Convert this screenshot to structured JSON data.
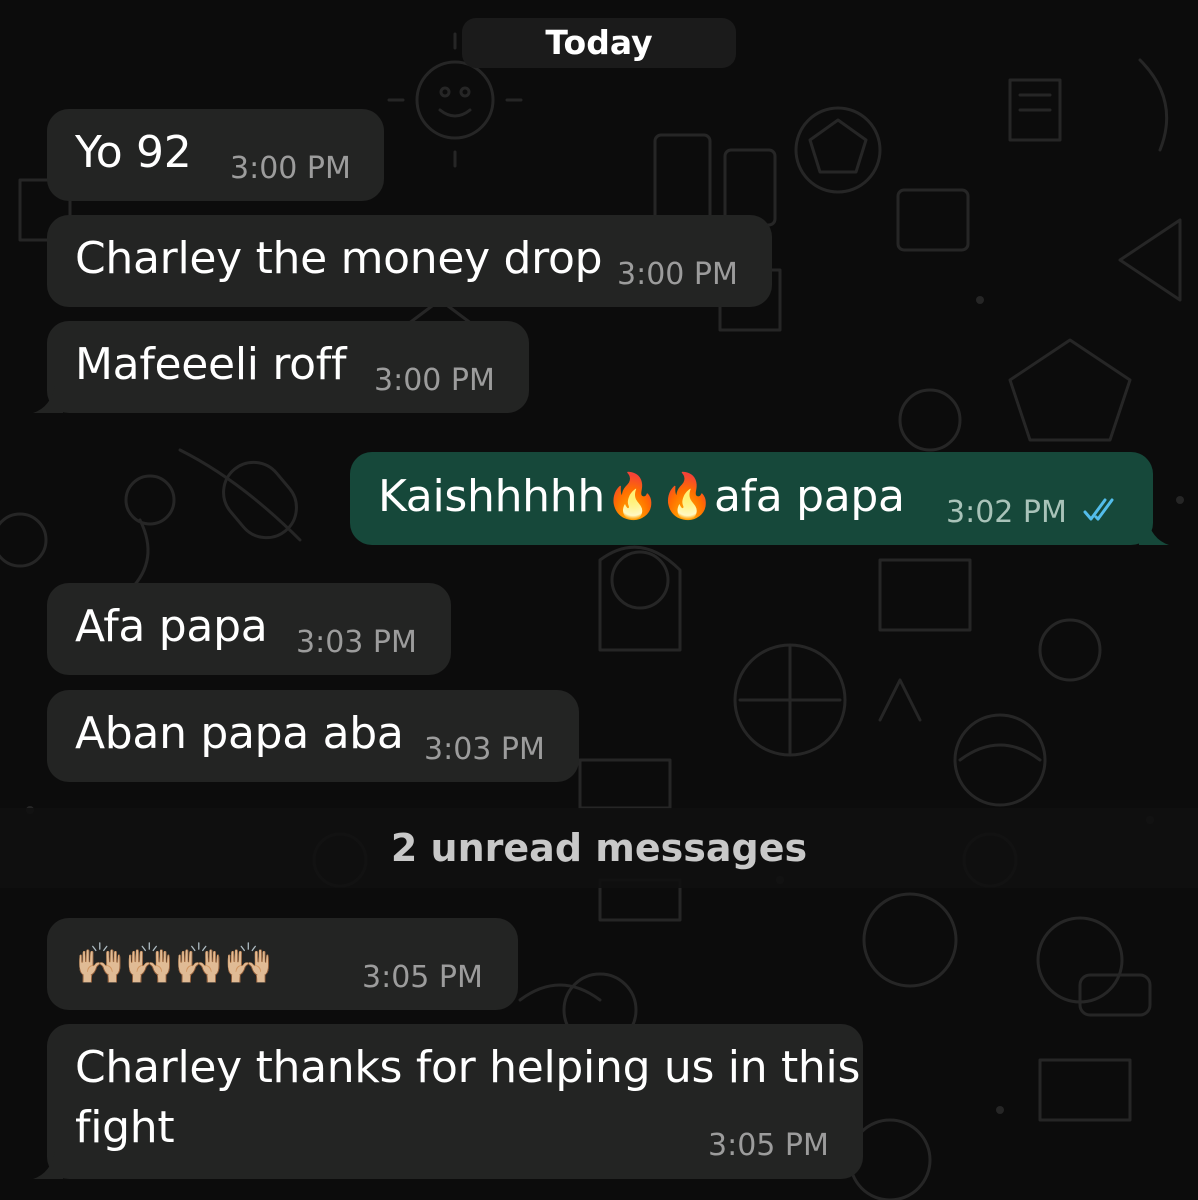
{
  "date_divider": "Today",
  "messages": [
    {
      "text": "Yo 92",
      "time": "3:00 PM",
      "direction": "incoming"
    },
    {
      "text": "Charley the money drop",
      "time": "3:00 PM",
      "direction": "incoming"
    },
    {
      "text": "Mafeeeli roff",
      "time": "3:00 PM",
      "direction": "incoming"
    },
    {
      "text_before": "Kaishhhhh",
      "emoji_1": "🔥",
      "emoji_2": "🔥",
      "text_after": "afa papa",
      "time": "3:02 PM",
      "direction": "outgoing",
      "status": "read"
    },
    {
      "text": "Afa papa",
      "time": "3:03 PM",
      "direction": "incoming"
    },
    {
      "text": "Aban papa aba",
      "time": "3:03 PM",
      "direction": "incoming"
    }
  ],
  "unread_divider": "2 unread messages",
  "unread_messages": [
    {
      "emoji": "🙌🏼🙌🏼🙌🏼🙌🏼",
      "time": "3:05 PM",
      "direction": "incoming"
    },
    {
      "text_line1": "Charley thanks for helping us in this",
      "text_line2": "fight",
      "time": "3:05 PM",
      "direction": "incoming"
    }
  ],
  "colors": {
    "background": "#0c0c0c",
    "incoming_bubble": "#232423",
    "outgoing_bubble": "#16483a",
    "read_ticks": "#53bdeb"
  }
}
